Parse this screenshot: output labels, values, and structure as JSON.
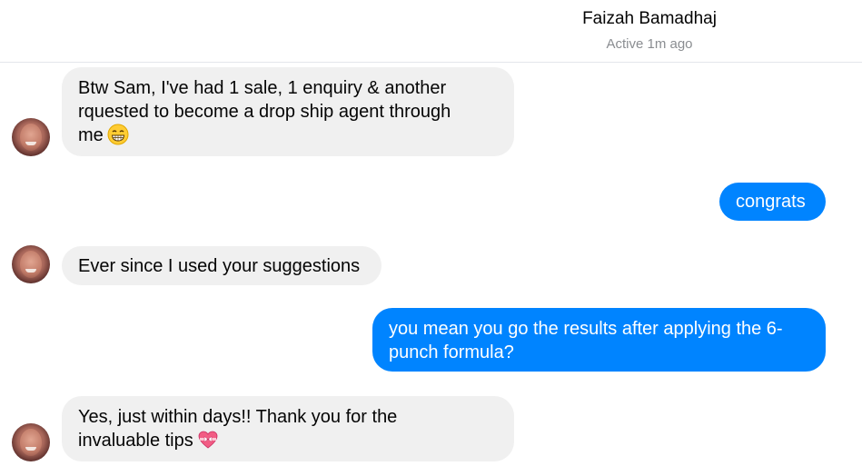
{
  "header": {
    "contact_name": "Faizah Bamadhaj",
    "status": "Active 1m ago"
  },
  "messages": [
    {
      "direction": "incoming",
      "lines": [
        "Btw Sam,  I've had 1 sale,  1 enquiry & another",
        "rquested to become a drop ship agent through",
        "me"
      ],
      "emoji": "grinning-face"
    },
    {
      "direction": "outgoing",
      "lines": [
        "congrats"
      ]
    },
    {
      "direction": "incoming",
      "lines": [
        "Ever since I used your suggestions"
      ]
    },
    {
      "direction": "outgoing",
      "lines": [
        "you mean you go the results after applying the 6-",
        "punch formula?"
      ]
    },
    {
      "direction": "incoming",
      "lines": [
        "Yes, just within days!! Thank you for the",
        "invaluable tips"
      ],
      "emoji": "heart-with-ribbon"
    }
  ],
  "colors": {
    "outgoing_bubble": "#0084ff",
    "incoming_bubble": "#f0f0f0",
    "status_text": "#8a8d91"
  }
}
